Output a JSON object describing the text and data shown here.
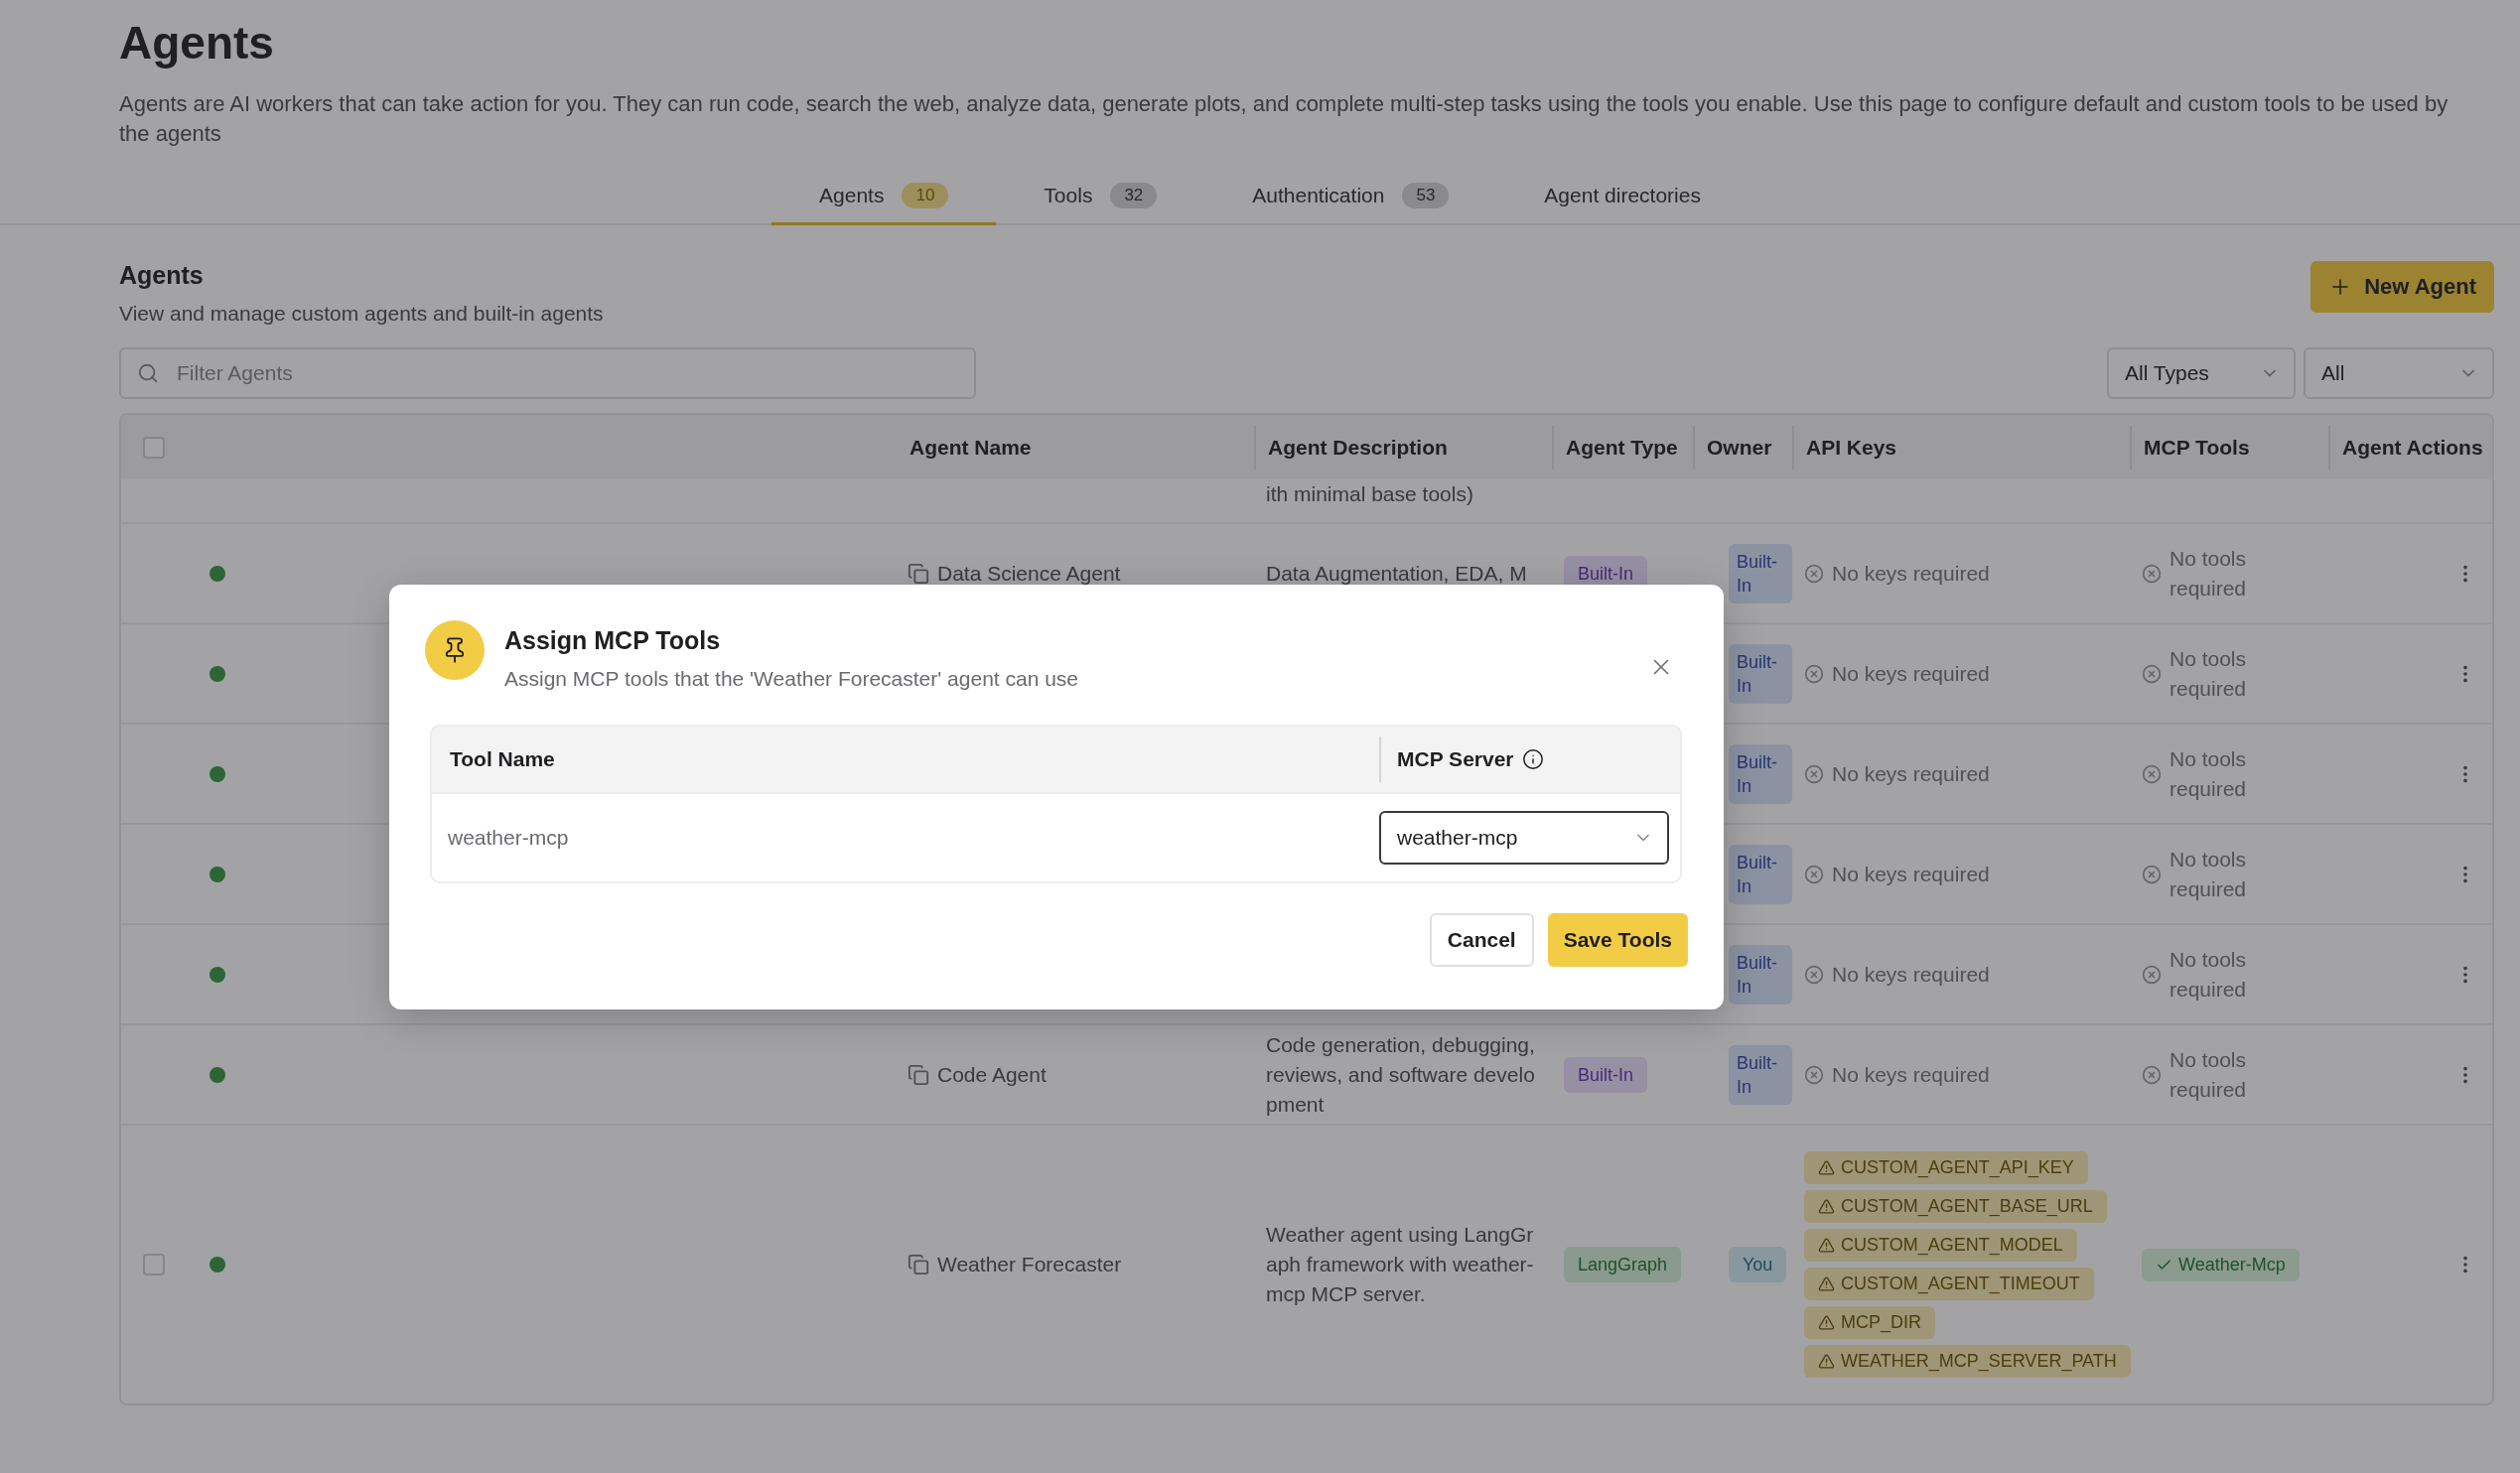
{
  "page": {
    "title": "Agents",
    "description": "Agents are AI workers that can take action for you. They can run code, search the web, analyze data, generate plots, and complete multi-step tasks using the tools you enable. Use this page to configure default and custom tools to be used by the agents"
  },
  "tabs": [
    {
      "label": "Agents",
      "count": "10",
      "selected": true
    },
    {
      "label": "Tools",
      "count": "32",
      "selected": false
    },
    {
      "label": "Authentication",
      "count": "53",
      "selected": false
    },
    {
      "label": "Agent directories",
      "selected": false
    }
  ],
  "section": {
    "title": "Agents",
    "subtitle": "View and manage custom agents and built-in agents",
    "new_button": "New Agent"
  },
  "filters": {
    "search_placeholder": "Filter Agents",
    "type_select": "All Types",
    "owner_select": "All"
  },
  "table": {
    "select_all": {
      "checked": false
    },
    "columns": [
      "Agent Name",
      "Agent Description",
      "Agent Type",
      "Owner",
      "API Keys",
      "MCP Tools",
      "Agent Actions"
    ],
    "partial_row": {
      "description": "ith minimal base tools)"
    },
    "rows": [
      {
        "name": "Data Science Agent",
        "description": "Data Augmentation, EDA, M",
        "type": {
          "kind": "builtin",
          "label": "Built-In"
        },
        "owner": {
          "kind": "builtin",
          "label": "Built-In"
        },
        "api_keys": {
          "kind": "none",
          "label": "No keys required"
        },
        "mcp_tools": {
          "kind": "none",
          "label": "No tools required"
        }
      },
      {
        "owner": {
          "kind": "builtin",
          "label": "Built-In"
        },
        "api_keys": {
          "kind": "none",
          "label": "No keys required"
        },
        "mcp_tools": {
          "kind": "none",
          "label": "No tools required"
        }
      },
      {
        "owner": {
          "kind": "builtin",
          "label": "Built-In"
        },
        "api_keys": {
          "kind": "none",
          "label": "No keys required"
        },
        "mcp_tools": {
          "kind": "none",
          "label": "No tools required"
        }
      },
      {
        "owner": {
          "kind": "builtin",
          "label": "Built-In"
        },
        "api_keys": {
          "kind": "none",
          "label": "No keys required"
        },
        "mcp_tools": {
          "kind": "none",
          "label": "No tools required"
        }
      },
      {
        "owner": {
          "kind": "builtin",
          "label": "Built-In"
        },
        "api_keys": {
          "kind": "none",
          "label": "No keys required"
        },
        "mcp_tools": {
          "kind": "none",
          "label": "No tools required"
        }
      },
      {
        "name": "Code Agent",
        "description": "Code generation, debugging, reviews, and software development",
        "type": {
          "kind": "builtin",
          "label": "Built-In"
        },
        "owner": {
          "kind": "builtin",
          "label": "Built-In"
        },
        "api_keys": {
          "kind": "none",
          "label": "No keys required"
        },
        "mcp_tools": {
          "kind": "none",
          "label": "No tools required"
        }
      },
      {
        "checked": false,
        "name": "Weather Forecaster",
        "description": "Weather agent using LangGraph framework with weather-mcp MCP server.",
        "type": {
          "kind": "langgraph",
          "label": "LangGraph"
        },
        "owner": {
          "kind": "user",
          "label": "You"
        },
        "api_keys": {
          "kind": "list",
          "keys": [
            "CUSTOM_AGENT_API_KEY",
            "CUSTOM_AGENT_BASE_URL",
            "CUSTOM_AGENT_MODEL",
            "CUSTOM_AGENT_TIMEOUT",
            "MCP_DIR",
            "WEATHER_MCP_SERVER_PATH"
          ]
        },
        "mcp_tools": {
          "kind": "list",
          "tools": [
            "Weather-Mcp"
          ]
        }
      }
    ]
  },
  "dialog": {
    "title": "Assign MCP Tools",
    "subtitle": "Assign MCP tools that the 'Weather Forecaster' agent can use",
    "columns": [
      "Tool Name",
      "MCP Server"
    ],
    "rows": [
      {
        "tool": "weather-mcp",
        "server": "weather-mcp"
      }
    ],
    "cancel": "Cancel",
    "save": "Save Tools"
  }
}
